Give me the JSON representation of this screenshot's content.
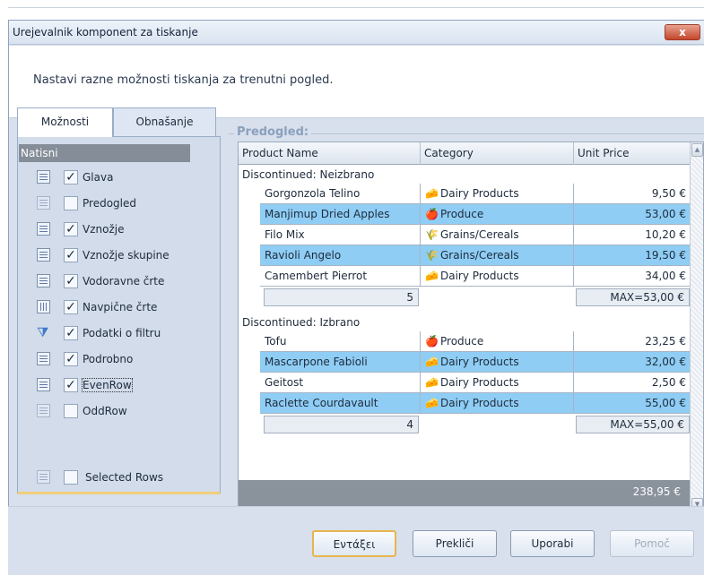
{
  "dialog": {
    "title": "Urejevalnik komponent za tiskanje",
    "close_label": "x",
    "header_text": "Nastavi razne možnosti tiskanja za trenutni pogled."
  },
  "tabs": [
    {
      "label": "Možnosti",
      "active": true
    },
    {
      "label": "Obnašanje",
      "active": false
    }
  ],
  "options_section": {
    "heading": "Natisni",
    "items": [
      {
        "label": "Glava",
        "checked": true,
        "icon": "header-icon"
      },
      {
        "label": "Predogled",
        "checked": false,
        "icon": "preview-icon",
        "disabled": true
      },
      {
        "label": "Vznožje",
        "checked": true,
        "icon": "footer-icon"
      },
      {
        "label": "Vznožje skupine",
        "checked": true,
        "icon": "group-footer-icon"
      },
      {
        "label": "Vodoravne črte",
        "checked": true,
        "icon": "horizontal-lines-icon"
      },
      {
        "label": "Navpične črte",
        "checked": true,
        "icon": "vertical-lines-icon"
      },
      {
        "label": "Podatki o filtru",
        "checked": true,
        "icon": "filter-icon"
      },
      {
        "label": "Podrobno",
        "checked": true,
        "icon": "detail-icon"
      },
      {
        "label": "EvenRow",
        "checked": true,
        "icon": "even-row-icon",
        "focused": true
      },
      {
        "label": "OddRow",
        "checked": false,
        "icon": "odd-row-icon",
        "disabled": true
      }
    ],
    "selected_rows": {
      "label": "Selected Rows",
      "checked": false,
      "icon": "selected-rows-icon"
    }
  },
  "preview": {
    "legend": "Predogled:",
    "columns": [
      "Product Name",
      "Category",
      "Unit Price"
    ],
    "groups": [
      {
        "header": "Discontinued: Neizbrano",
        "rows": [
          {
            "name": "Gorgonzola Telino",
            "category": "Dairy Products",
            "icon": "🧀",
            "price": "9,50 €"
          },
          {
            "name": "Manjimup Dried Apples",
            "category": "Produce",
            "icon": "🍎",
            "price": "53,00 €"
          },
          {
            "name": "Filo Mix",
            "category": "Grains/Cereals",
            "icon": "🌾",
            "price": "10,20 €"
          },
          {
            "name": "Ravioli Angelo",
            "category": "Grains/Cereals",
            "icon": "🌾",
            "price": "19,50 €"
          },
          {
            "name": "Camembert Pierrot",
            "category": "Dairy Products",
            "icon": "🧀",
            "price": "34,00 €"
          }
        ],
        "count": "5",
        "max": "MAX=53,00 €"
      },
      {
        "header": "Discontinued: Izbrano",
        "rows": [
          {
            "name": "Tofu",
            "category": "Produce",
            "icon": "🍎",
            "price": "23,25 €"
          },
          {
            "name": "Mascarpone Fabioli",
            "category": "Dairy Products",
            "icon": "🧀",
            "price": "32,00 €"
          },
          {
            "name": "Geitost",
            "category": "Dairy Products",
            "icon": "🧀",
            "price": "2,50 €"
          },
          {
            "name": "Raclette Courdavault",
            "category": "Dairy Products",
            "icon": "🧀",
            "price": "55,00 €"
          }
        ],
        "count": "4",
        "max": "MAX=55,00 €"
      }
    ],
    "grand_total": "238,95 €"
  },
  "buttons": {
    "ok": "Εντάξει",
    "cancel": "Prekliči",
    "apply": "Uporabi",
    "help": "Pomoč"
  },
  "colors": {
    "alt_row": "#8fcdf4",
    "accent": "#f1ce7a"
  }
}
